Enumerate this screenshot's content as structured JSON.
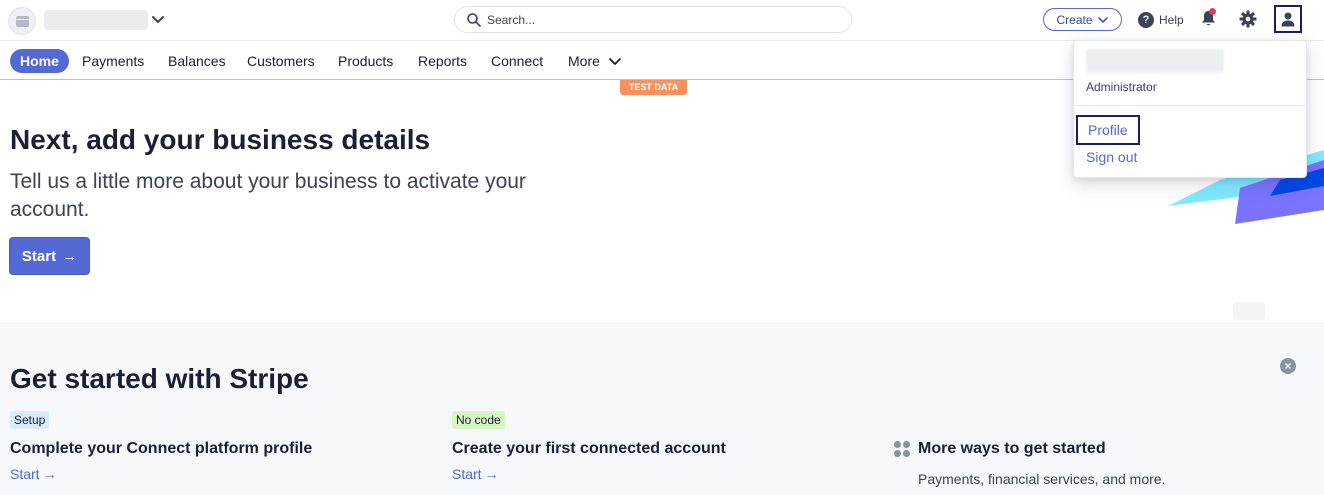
{
  "header": {
    "search": {
      "placeholder": "Search..."
    },
    "create_label": "Create",
    "help_label": "Help"
  },
  "nav": {
    "items": [
      {
        "label": "Home",
        "active": true
      },
      {
        "label": "Payments"
      },
      {
        "label": "Balances"
      },
      {
        "label": "Customers"
      },
      {
        "label": "Products"
      },
      {
        "label": "Reports"
      },
      {
        "label": "Connect"
      },
      {
        "label": "More"
      }
    ],
    "test_badge": "TEST DATA"
  },
  "hero": {
    "title": "Next, add your business details",
    "subtitle": "Tell us a little more about your business to activate your account.",
    "start_label": "Start",
    "start_arrow": "→"
  },
  "get_started": {
    "title": "Get started with Stripe",
    "cards": [
      {
        "tag": "Setup",
        "title": "Complete your Connect platform profile",
        "link": "Start",
        "arrow": "→"
      },
      {
        "tag": "No code",
        "title": "Create your first connected account",
        "link": "Start",
        "arrow": "→"
      },
      {
        "title": "More ways to get started",
        "description": "Payments, financial services, and more."
      }
    ]
  },
  "user_menu": {
    "role": "Administrator",
    "profile_label": "Profile",
    "signout_label": "Sign out"
  },
  "colors": {
    "accent": "#5469d4",
    "nav_underline": "#f0b08a",
    "test_badge": "#f5925e",
    "notification_dot": "#e23e57"
  },
  "icons": [
    "store-icon",
    "chevron-down-icon",
    "search-icon",
    "help-icon",
    "bell-icon",
    "gear-icon",
    "user-icon",
    "close-icon",
    "grid-icon",
    "arrow-right-icon"
  ]
}
